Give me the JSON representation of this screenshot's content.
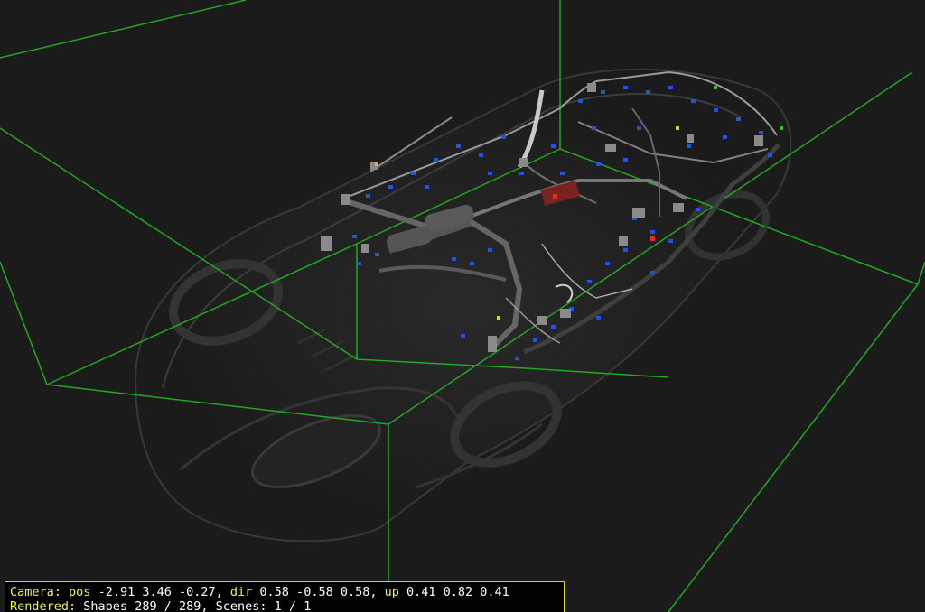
{
  "viewer": {
    "background_color": "#1b1b1b",
    "grid_color": "#22a822",
    "model": "car-wiring-harness"
  },
  "status": {
    "camera_label": "Camera:",
    "pos_label": "pos",
    "pos_value": "-2.91 3.46 -0.27,",
    "dir_label": "dir",
    "dir_value": "0.58 -0.58 0.58,",
    "up_label": "up",
    "up_value": "0.41 0.82 0.41",
    "rendered_label": "Rendered:",
    "shapes_text": "Shapes 289 / 289, Scenes: 1 / 1",
    "label_color": "#f2f23a",
    "border_color": "#d8d820"
  }
}
